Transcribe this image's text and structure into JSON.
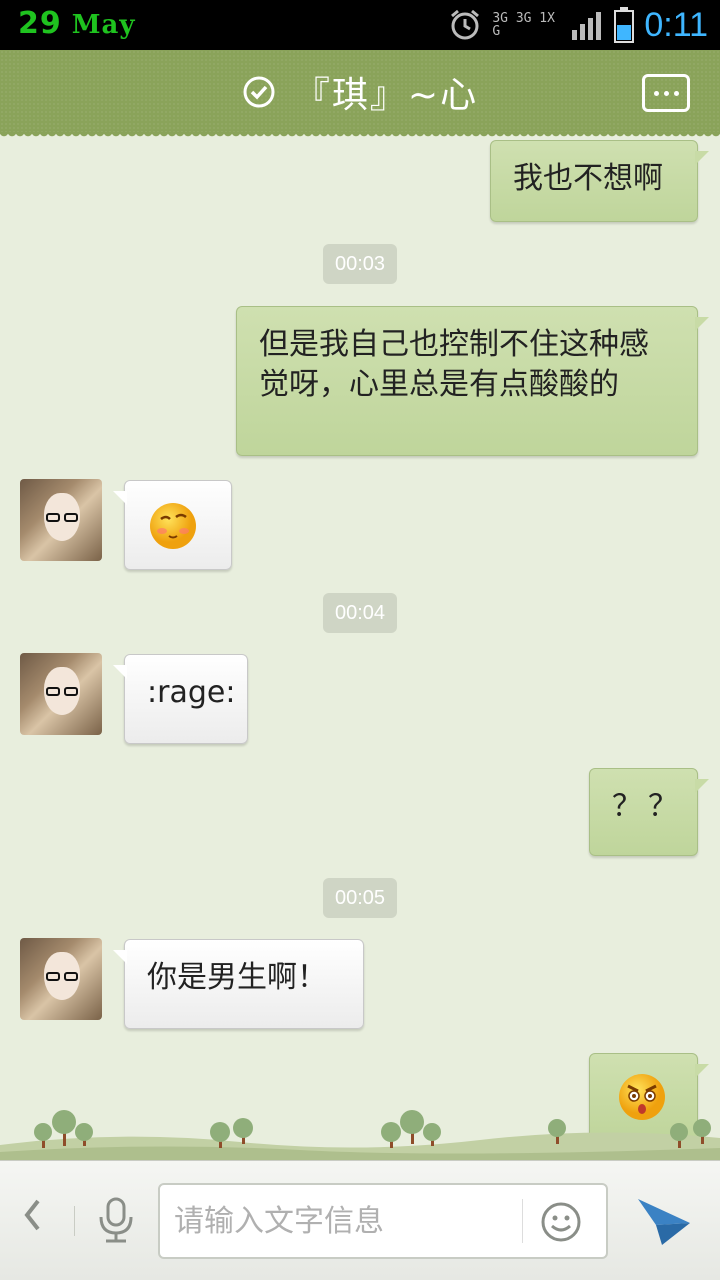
{
  "status_bar": {
    "day": "29",
    "month": "May",
    "network_top": "3G 3G 1X  G",
    "time": "0:11"
  },
  "header": {
    "title": "『琪』~心",
    "verified_icon": "check-circle-icon",
    "menu_icon": "more-icon"
  },
  "chat": {
    "messages": [
      {
        "side": "right",
        "text": "我也不想啊"
      },
      {
        "timestamp": "00:03"
      },
      {
        "side": "right",
        "text": "但是我自己也控制不住这种感觉呀，心里总是有点酸酸的"
      },
      {
        "side": "left",
        "emoji": "embarrassed-emoji"
      },
      {
        "timestamp": "00:04"
      },
      {
        "side": "left",
        "text": ":rage:"
      },
      {
        "side": "right",
        "text": "？？"
      },
      {
        "timestamp": "00:05"
      },
      {
        "side": "left",
        "text": "你是男生啊！"
      },
      {
        "side": "right",
        "emoji": "angry-emoji"
      }
    ]
  },
  "input_bar": {
    "placeholder": "请输入文字信息"
  },
  "colors": {
    "header_green": "#8aa35a",
    "bubble_green": "#c8dba6",
    "time_blue": "#3fb6ff",
    "date_green": "#1fc31f"
  }
}
